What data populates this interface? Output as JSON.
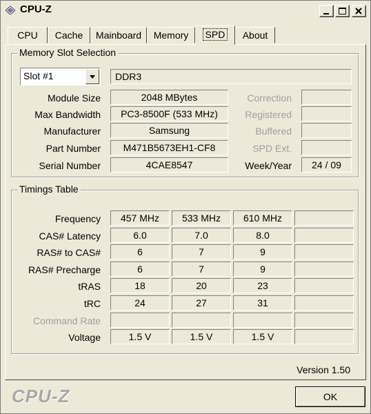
{
  "window": {
    "title": "CPU-Z"
  },
  "tabs": [
    {
      "label": "CPU"
    },
    {
      "label": "Cache"
    },
    {
      "label": "Mainboard"
    },
    {
      "label": "Memory"
    },
    {
      "label": "SPD"
    },
    {
      "label": "About"
    }
  ],
  "active_tab": "SPD",
  "memory_slot": {
    "title": "Memory Slot Selection",
    "selected_slot": "Slot #1",
    "type": "DDR3",
    "labels": {
      "module_size": "Module Size",
      "max_bandwidth": "Max Bandwidth",
      "manufacturer": "Manufacturer",
      "part_number": "Part Number",
      "serial_number": "Serial Number",
      "correction": "Correction",
      "registered": "Registered",
      "buffered": "Buffered",
      "spd_ext": "SPD Ext.",
      "week_year": "Week/Year"
    },
    "values": {
      "module_size": "2048 MBytes",
      "max_bandwidth": "PC3-8500F (533 MHz)",
      "manufacturer": "Samsung",
      "part_number": "M471B5673EH1-CF8",
      "serial_number": "4CAE8547",
      "correction": "",
      "registered": "",
      "buffered": "",
      "spd_ext": "",
      "week_year": "24 / 09"
    }
  },
  "timings": {
    "title": "Timings Table",
    "rows": [
      {
        "label": "Frequency",
        "values": [
          "457 MHz",
          "533 MHz",
          "610 MHz",
          ""
        ],
        "dim": false
      },
      {
        "label": "CAS# Latency",
        "values": [
          "6.0",
          "7.0",
          "8.0",
          ""
        ],
        "dim": false
      },
      {
        "label": "RAS# to CAS#",
        "values": [
          "6",
          "7",
          "9",
          ""
        ],
        "dim": false
      },
      {
        "label": "RAS# Precharge",
        "values": [
          "6",
          "7",
          "9",
          ""
        ],
        "dim": false
      },
      {
        "label": "tRAS",
        "values": [
          "18",
          "20",
          "23",
          ""
        ],
        "dim": false
      },
      {
        "label": "tRC",
        "values": [
          "24",
          "27",
          "31",
          ""
        ],
        "dim": false
      },
      {
        "label": "Command Rate",
        "values": [
          "",
          "",
          "",
          ""
        ],
        "dim": true
      },
      {
        "label": "Voltage",
        "values": [
          "1.5 V",
          "1.5 V",
          "1.5 V",
          ""
        ],
        "dim": false
      }
    ]
  },
  "footer": {
    "brand": "CPU-Z",
    "version": "Version 1.50",
    "ok_label": "OK"
  },
  "colors": {
    "background": "#ece9d8",
    "dim_text": "#a0a0a0"
  }
}
